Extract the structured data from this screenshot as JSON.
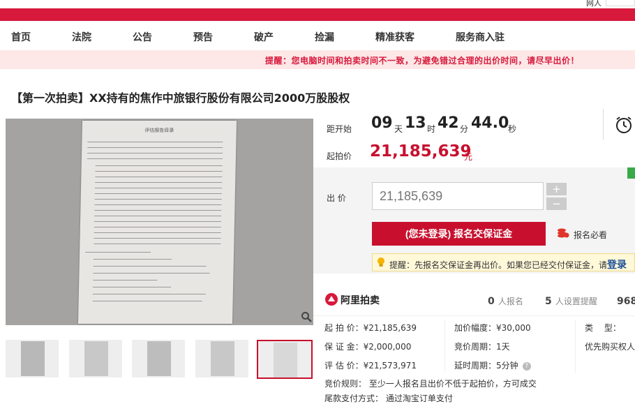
{
  "top": {
    "mini_text": "网人"
  },
  "nav": {
    "items": [
      "首页",
      "法院",
      "公告",
      "预告",
      "破产",
      "捡漏",
      "精准获客",
      "服务商入驻"
    ]
  },
  "notice": {
    "text": "提醒：您电脑时间和拍卖时间不一致，为避免错过合理的出价时间，请尽早出价！"
  },
  "item": {
    "title": "【第一次拍卖】XX持有的焦作中旅银行股份有限公司2000万股股权"
  },
  "gallery": {
    "doc_title": "评估报告目录",
    "thumb_count": 5,
    "active_thumb": 5
  },
  "countdown": {
    "label": "距开始",
    "days": "09",
    "days_unit": "天",
    "hours": "13",
    "hours_unit": "时",
    "minutes": "42",
    "minutes_unit": "分",
    "seconds": "44.0",
    "seconds_unit": "秒"
  },
  "start_price": {
    "label": "起拍价",
    "value": "21,185,639",
    "unit": "元"
  },
  "bid": {
    "label": "出 价",
    "placeholder": "21,185,639",
    "plus": "+",
    "minus": "−",
    "signup_button": "(您未登录) 报名交保证金",
    "must_read": "报名必看",
    "tip": "提醒：先报名交保证金再出价。如果您已经交付保证金，请",
    "tip_link": "登录"
  },
  "platform": {
    "name": "阿里拍卖",
    "signups_n": "0",
    "signups_t": "人报名",
    "reminders_n": "5",
    "reminders_t": "人设置提醒",
    "views_n": "968"
  },
  "details": {
    "start_price": "起 拍 价：¥21,185,639",
    "deposit": "保 证 金：¥2,000,000",
    "valuation": "评 估 价：¥21,573,971",
    "increment": "加价幅度：¥30,000",
    "cycle": "竞价周期：1天",
    "extension": "延时周期：5分钟",
    "type_label": "类　 型：",
    "priority": "优先购买权人",
    "rule": "竞价规则：  至少一人报名且出价不低于起拍价，方可成交",
    "payment": "尾款支付方式：   通过淘宝订单支付"
  },
  "colors": {
    "brand_red": "#d7193c",
    "price_red": "#c8102e",
    "notice_bg": "#fde7e7"
  }
}
